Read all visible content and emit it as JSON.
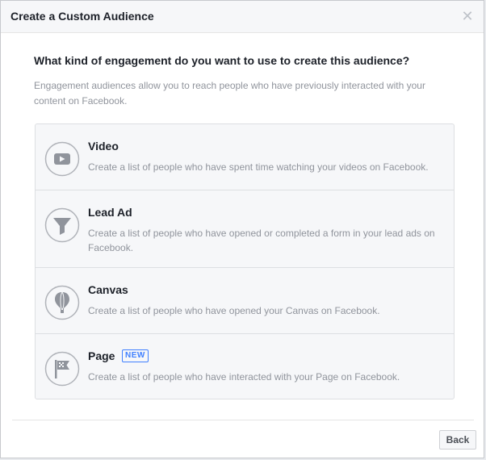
{
  "dialog": {
    "title": "Create a Custom Audience",
    "close_icon": "close-icon"
  },
  "content": {
    "question": "What kind of engagement do you want to use to create this audience?",
    "description": "Engagement audiences allow you to reach people who have previously interacted with your content on Facebook."
  },
  "options": [
    {
      "icon": "video-icon",
      "title": "Video",
      "description": "Create a list of people who have spent time watching your videos on Facebook."
    },
    {
      "icon": "funnel-icon",
      "title": "Lead Ad",
      "description": "Create a list of people who have opened or completed a form in your lead ads on Facebook."
    },
    {
      "icon": "balloon-icon",
      "title": "Canvas",
      "description": "Create a list of people who have opened your Canvas on Facebook."
    },
    {
      "icon": "flag-icon",
      "title": "Page",
      "badge": "NEW",
      "description": "Create a list of people who have interacted with your Page on Facebook."
    }
  ],
  "footer": {
    "back_label": "Back"
  },
  "colors": {
    "badge_blue": "#4080ff",
    "icon_gray": "#90949c",
    "panel_bg": "#f6f7f9"
  }
}
